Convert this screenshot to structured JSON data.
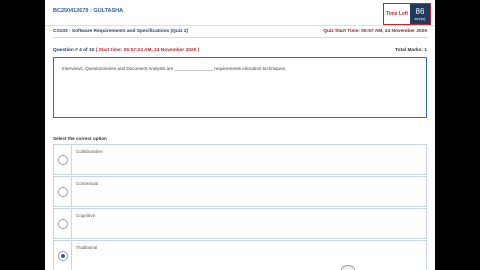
{
  "header": {
    "student": "BC250412679 : GULTASHA",
    "timer_label": "Time Left",
    "timer_value": "86",
    "timer_unit": "sec(s)"
  },
  "course": {
    "title": "CS103 - Software Requirements and Specifications (Quiz 2)",
    "start_time": "Quiz Start Time: 05:57 AM, 24 November 2025"
  },
  "question": {
    "number": "Question # 4 of 10",
    "start_time": "( Start time: 05:57:24 AM, 24 November 2025 )",
    "total_marks": "Total Marks: 1",
    "text": "Interviews, Questionnaires and Document Analysis are _______________ requirements elicitation techniques."
  },
  "select_label": "Select the correct option",
  "options": [
    {
      "label": "Collaborative",
      "selected": false
    },
    {
      "label": "Contextual",
      "selected": false
    },
    {
      "label": "Cognitive",
      "selected": false
    },
    {
      "label": "Traditional",
      "selected": true
    }
  ]
}
